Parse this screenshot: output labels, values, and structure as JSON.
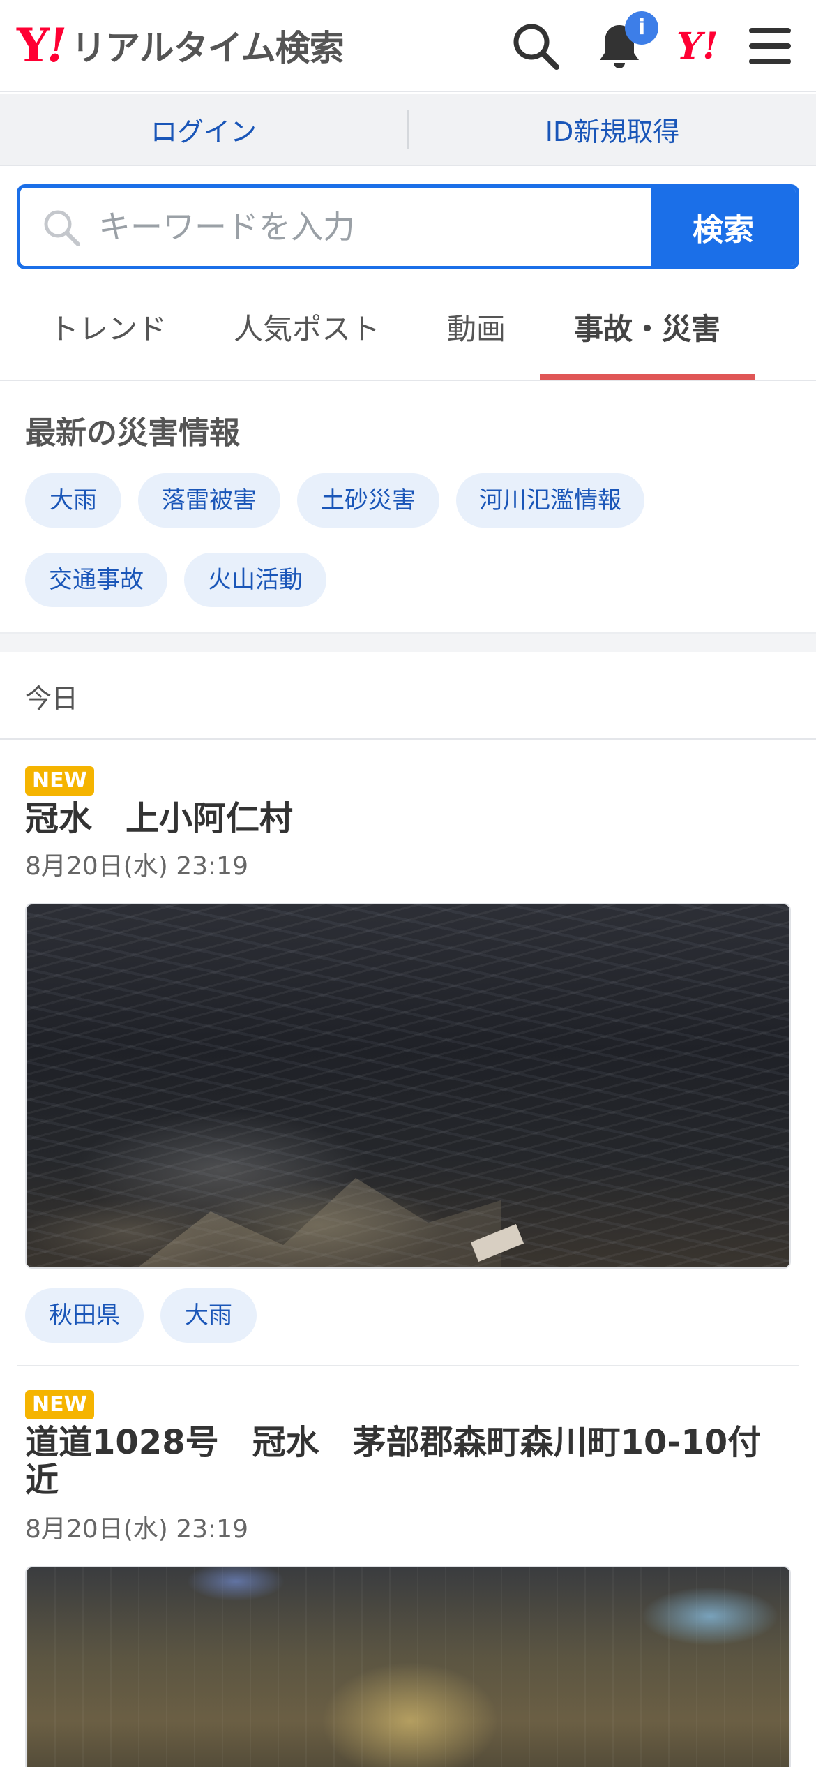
{
  "header": {
    "logo_y": "Y",
    "logo_ex": "!",
    "logo_text": "リアルタイム検索",
    "notification_badge": "i",
    "yj_mark": "Y!",
    "icons": [
      "search-icon",
      "bell-icon",
      "yahoo-japan-icon",
      "menu-icon"
    ]
  },
  "login_bar": {
    "login": "ログイン",
    "register": "ID新規取得"
  },
  "search": {
    "placeholder": "キーワードを入力",
    "value": "",
    "button": "検索"
  },
  "tabs": [
    {
      "label": "トレンド",
      "active": false
    },
    {
      "label": "人気ポスト",
      "active": false
    },
    {
      "label": "動画",
      "active": false
    },
    {
      "label": "事故・災害",
      "active": true
    }
  ],
  "disaster": {
    "title": "最新の災害情報",
    "chips": [
      "大雨",
      "落雷被害",
      "土砂災害",
      "河川氾濫情報",
      "交通事故",
      "火山活動"
    ]
  },
  "today_label": "今日",
  "posts": [
    {
      "badge": "NEW",
      "title": "冠水　上小阿仁村",
      "date": "8月20日(水) 23:19",
      "tags": [
        "秋田県",
        "大雨"
      ]
    },
    {
      "badge": "NEW",
      "title": "道道1028号　冠水　茅部郡森町森川町10-10付近",
      "date": "8月20日(水) 23:19",
      "tags": []
    }
  ],
  "colors": {
    "brand_red": "#ff0033",
    "primary_blue": "#1b6fe8",
    "link_blue": "#1a56b8",
    "tab_underline": "#e05656",
    "new_badge": "#f5b400",
    "chip_bg": "#e8f0fb"
  }
}
